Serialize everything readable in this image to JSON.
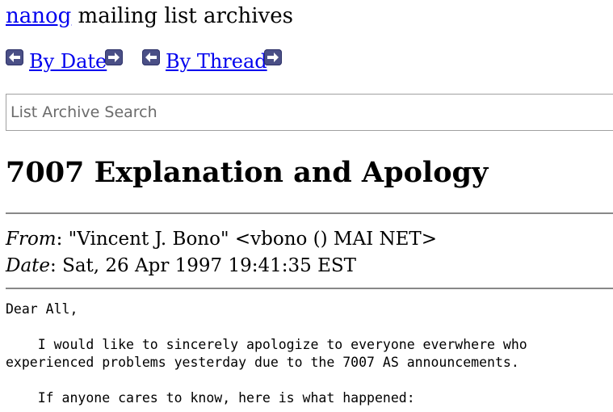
{
  "header": {
    "list_name": "nanog",
    "title_suffix": " mailing list archives"
  },
  "nav": {
    "by_date_label": "By Date",
    "by_thread_label": "By Thread"
  },
  "search": {
    "placeholder": "List Archive Search",
    "value": ""
  },
  "message": {
    "subject": "7007 Explanation and Apology",
    "from_label": "From",
    "from_value": ": \"Vincent J. Bono\" <vbono () MAI NET>",
    "date_label": "Date",
    "date_value": ": Sat, 26 Apr 1997 19:41:35 EST",
    "body_lines": [
      "Dear All,",
      "",
      "    I would like to sincerely apologize to everyone everwhere who",
      "experienced problems yesterday due to the 7007 AS announcements.",
      "",
      "    If anyone cares to know, here is what happened:"
    ]
  },
  "colors": {
    "link": "#0000ee",
    "nav_icon": "#4a4f86",
    "rule": "#888888"
  }
}
